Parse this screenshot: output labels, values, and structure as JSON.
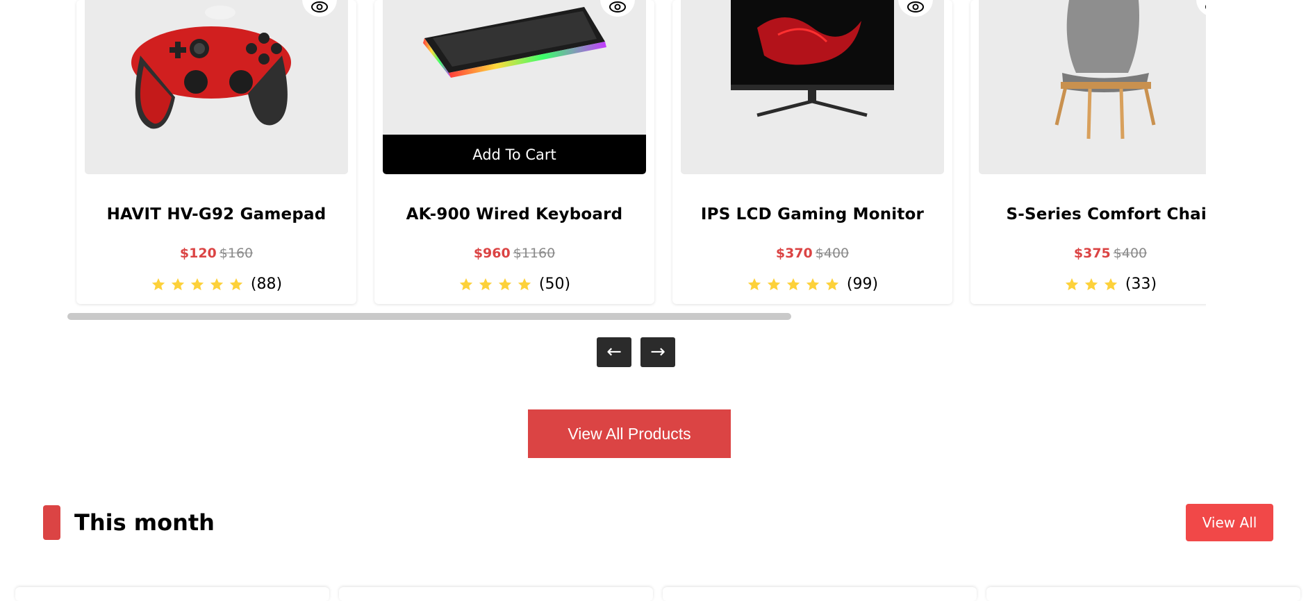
{
  "carousel": {
    "products": [
      {
        "title": "HAVIT HV-G92 Gamepad",
        "price": "$120",
        "old_price": "$160",
        "stars": 5,
        "reviews": "(88)",
        "image": "gamepad",
        "show_cart": false
      },
      {
        "title": "AK-900 Wired Keyboard",
        "price": "$960",
        "old_price": "$1160",
        "stars": 4,
        "reviews": "(50)",
        "image": "keyboard",
        "show_cart": true
      },
      {
        "title": "IPS LCD Gaming Monitor",
        "price": "$370",
        "old_price": "$400",
        "stars": 5,
        "reviews": "(99)",
        "image": "monitor",
        "show_cart": false
      },
      {
        "title": "S-Series Comfort Chair",
        "price": "$375",
        "old_price": "$400",
        "stars": 3,
        "reviews": "(33)",
        "image": "chair",
        "show_cart": false
      }
    ],
    "add_to_cart_label": "Add To Cart",
    "prev_label": "←",
    "next_label": "→",
    "star_color": "#fdd13a",
    "price_color": "#db4444"
  },
  "view_all_products_label": "View All Products",
  "this_month": {
    "title": "This month",
    "view_all_label": "View All",
    "accent": "#db4444"
  }
}
